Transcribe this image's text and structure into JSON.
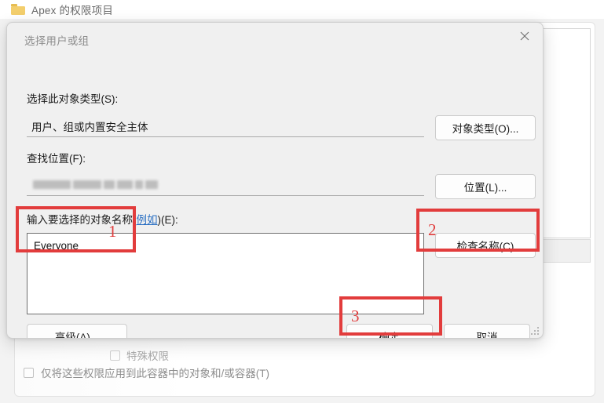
{
  "background_window": {
    "header_title": "Apex 的权限项目",
    "folder_icon": "folder-icon",
    "special_permission_label": "特殊权限",
    "apply_to_container_label": "仅将这些权限应用到此容器中的对象和/或容器(T)"
  },
  "dialog": {
    "title": "选择用户或组",
    "close_icon": "close-icon",
    "object_type": {
      "label": "选择此对象类型(S):",
      "value": "用户、组或内置安全主体",
      "button_label": "对象类型(O)..."
    },
    "location": {
      "label": "查找位置(F):",
      "value": "",
      "value_redacted": true,
      "button_label": "位置(L)..."
    },
    "names": {
      "label_prefix": "输入要选择的对象名称(",
      "label_link": "例如",
      "label_suffix": ")(E):",
      "value": "Everyone",
      "check_names_button": "检查名称(C)"
    },
    "footer": {
      "advanced_button": "高级(A)...",
      "ok_button": "确定",
      "cancel_button": "取消"
    },
    "resize_grip_icon": "resize-grip-icon"
  },
  "annotations": {
    "accent_color": "#e03c3c",
    "markers": [
      {
        "number": "1",
        "target": "names-input"
      },
      {
        "number": "2",
        "target": "check-names-button"
      },
      {
        "number": "3",
        "target": "ok-button"
      }
    ]
  }
}
